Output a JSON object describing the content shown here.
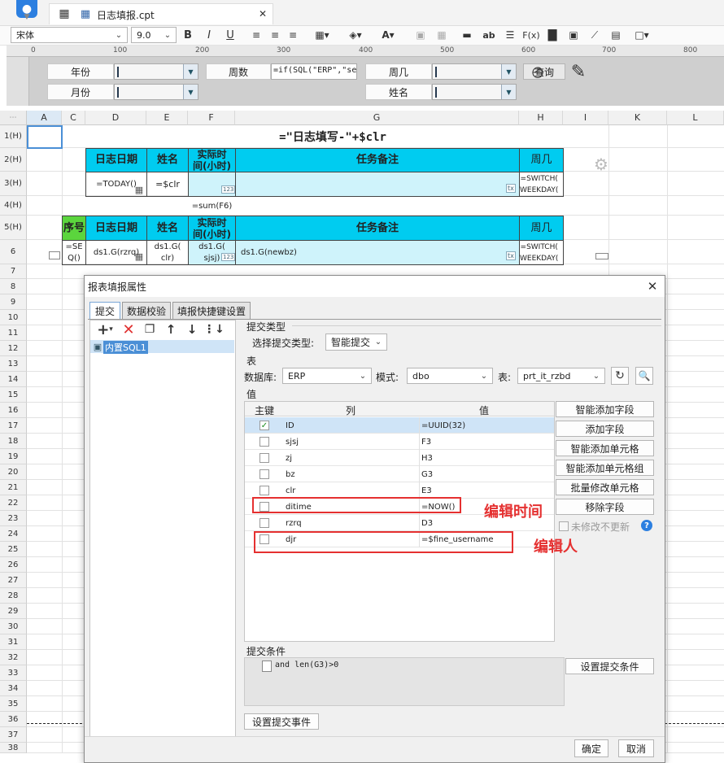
{
  "app": {
    "tab_title": "日志填报.cpt"
  },
  "toolbar": {
    "font_family": "宋体",
    "font_size": "9.0"
  },
  "ruler": {
    "marks": [
      "0",
      "100",
      "200",
      "300",
      "400",
      "500",
      "600",
      "700",
      "800"
    ]
  },
  "params": {
    "year_label": "年份",
    "month_label": "月份",
    "week_label": "周数",
    "week_expr": "=if(SQL(\"ERP\",\"se",
    "weekday_label": "周几",
    "name_label": "姓名",
    "query_button": "查询"
  },
  "sheet": {
    "columns": [
      "A",
      "C",
      "D",
      "E",
      "F",
      "G",
      "H",
      "I",
      "K",
      "L"
    ],
    "rows": [
      "1(H)",
      "2(H)",
      "3(H)",
      "4(H)",
      "5(H)",
      "6",
      "7",
      "8",
      "9",
      "10",
      "11",
      "12",
      "13",
      "14",
      "15",
      "16",
      "17",
      "18",
      "19",
      "20",
      "21",
      "22",
      "23",
      "24",
      "25",
      "26",
      "27",
      "28",
      "29",
      "30",
      "31",
      "32",
      "33",
      "34",
      "35",
      "36",
      "37",
      "38"
    ],
    "cells": {
      "title": "=\"日志填写-\"+$clr",
      "h_date": "日志日期",
      "h_name": "姓名",
      "h_hours": "实际时\n间(小时)",
      "h_note": "任务备注",
      "h_weekday": "周几",
      "r3_date": "=TODAY()",
      "r3_name": "=$clr",
      "r3_weekday": "=SWITCH(\nWEEKDAY(",
      "r4_sum": "=sum(F6)",
      "h_seq": "序号",
      "h2_date": "日志日期",
      "h2_name": "姓名",
      "h2_hours": "实际时\n间(小时)",
      "h2_note": "任务备注",
      "h2_weekday": "周几",
      "r6_seq": "=SE\nQ()",
      "r6_date": "ds1.G(rzrq)",
      "r6_name": "ds1.G(\nclr)",
      "r6_hours": "ds1.G(\nsjsj)",
      "r6_note": "ds1.G(newbz)",
      "r6_weekday": "=SWITCH(\nWEEKDAY(",
      "num_badge": "123",
      "tx_badge": "tx"
    }
  },
  "dialog": {
    "title": "报表填报属性",
    "tabs": [
      "提交",
      "数据校验",
      "填报快捷键设置"
    ],
    "tree_item": "内置SQL1",
    "submit_type_section": "提交类型",
    "submit_type_label": "选择提交类型:",
    "submit_type_value": "智能提交",
    "table_section": "表",
    "db_label": "数据库:",
    "db_value": "ERP",
    "mode_label": "模式:",
    "mode_value": "dbo",
    "table_label": "表:",
    "table_value": "prt_it_rzbd",
    "value_section": "值",
    "col_headers": [
      "主键",
      "列",
      "值"
    ],
    "rows": [
      {
        "key": true,
        "col": "ID",
        "val": "=UUID(32)"
      },
      {
        "key": false,
        "col": "sjsj",
        "val": "F3"
      },
      {
        "key": false,
        "col": "zj",
        "val": "H3"
      },
      {
        "key": false,
        "col": "bz",
        "val": "G3"
      },
      {
        "key": false,
        "col": "clr",
        "val": "E3"
      },
      {
        "key": false,
        "col": "ditime",
        "val": "=NOW()"
      },
      {
        "key": false,
        "col": "rzrq",
        "val": "D3"
      },
      {
        "key": false,
        "col": "djr",
        "val": "=$fine_username"
      }
    ],
    "side_buttons": [
      "智能添加字段",
      "添加字段",
      "智能添加单元格",
      "智能添加单元格组",
      "批量修改单元格",
      "移除字段"
    ],
    "no_update_label": "未修改不更新",
    "condition_section": "提交条件",
    "condition_expr": "and len(G3)>0",
    "set_condition_button": "设置提交条件",
    "set_event_button": "设置提交事件",
    "ok_button": "确定",
    "cancel_button": "取消"
  },
  "annotations": {
    "edit_time": "编辑时间",
    "editor": "编辑人"
  },
  "colors": {
    "cyan": "#00ccf0",
    "green": "#5bd53d",
    "annotation": "#e53030",
    "selected": "#cfe4f7"
  }
}
